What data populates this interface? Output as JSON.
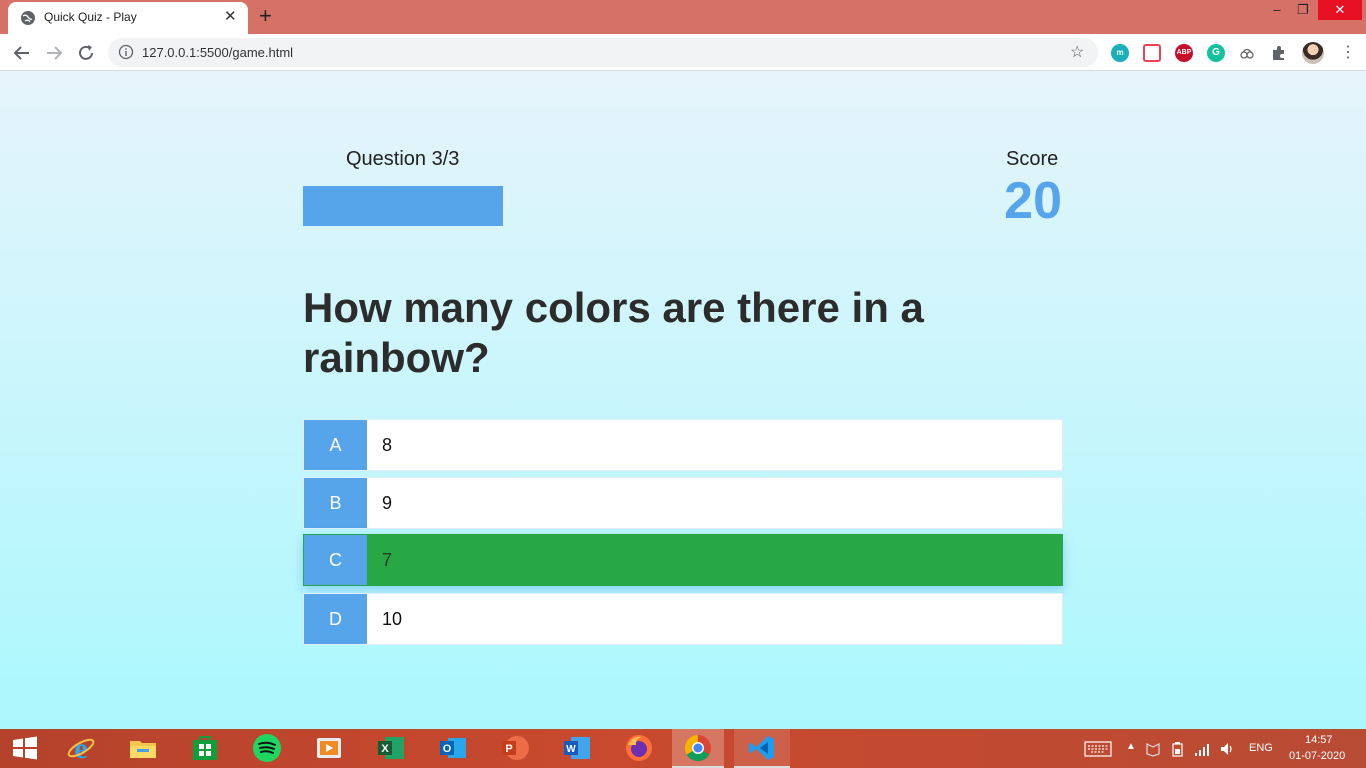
{
  "browser": {
    "tab_title": "Quick Quiz - Play",
    "tab_close": "✕",
    "new_tab": "+",
    "window_controls": {
      "minimize": "–",
      "maximize": "❐",
      "close": "✕"
    },
    "url": "127.0.0.1:5500/game.html",
    "extensions": [
      {
        "name": "m-extension-icon",
        "label": "m",
        "color": "#1ab0b8"
      },
      {
        "name": "pocket-icon",
        "label": "",
        "color": "#ef4056"
      },
      {
        "name": "adblock-plus-icon",
        "label": "ABP",
        "color": "#c70d2c"
      },
      {
        "name": "grammarly-icon",
        "label": "G",
        "color": "#15c39a"
      }
    ]
  },
  "game": {
    "progress_text": "Question 3/3",
    "progress_fraction": 1.0,
    "score_label": "Score",
    "score_value": "20",
    "question": "How many colors are there in a rainbow?",
    "choices": [
      {
        "prefix": "A",
        "text": "8",
        "state": "default"
      },
      {
        "prefix": "B",
        "text": "9",
        "state": "default"
      },
      {
        "prefix": "C",
        "text": "7",
        "state": "correct"
      },
      {
        "prefix": "D",
        "text": "10",
        "state": "default"
      }
    ]
  },
  "colors": {
    "accent": "#56a5eb",
    "correct": "#28a745",
    "titlebar": "#d67168",
    "taskbar": "#c94a2e"
  },
  "taskbar": {
    "apps": [
      "start-icon",
      "internet-explorer-icon",
      "file-explorer-icon",
      "microsoft-store-icon",
      "spotify-icon",
      "media-player-icon",
      "excel-icon",
      "outlook-icon",
      "powerpoint-icon",
      "word-icon",
      "firefox-icon",
      "chrome-icon",
      "vscode-icon"
    ],
    "language": "ENG",
    "time": "14:57",
    "date": "01-07-2020"
  }
}
